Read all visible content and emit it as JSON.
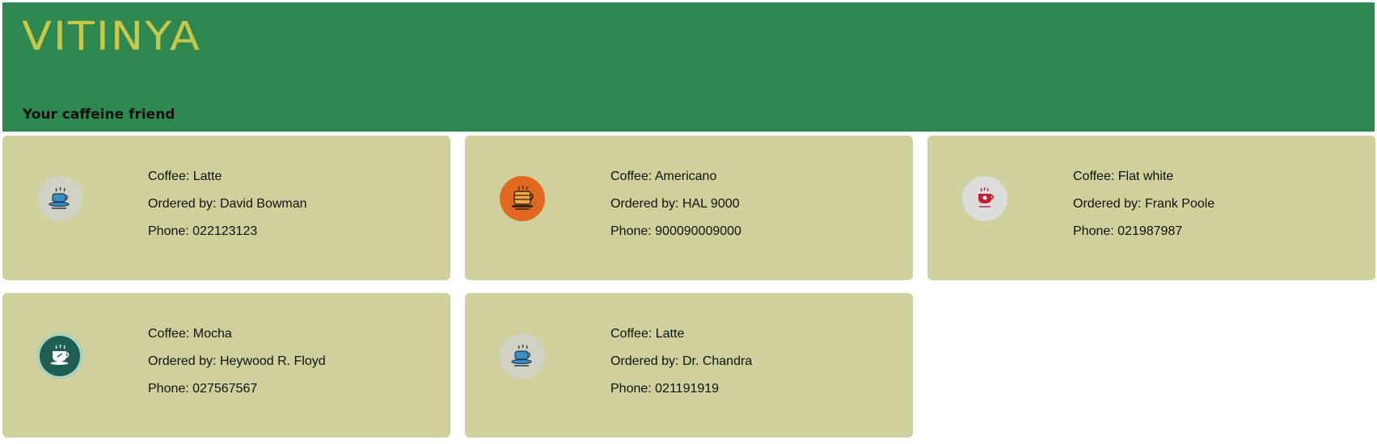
{
  "header": {
    "brand": "VITINYA",
    "tagline": "Your caffeine friend"
  },
  "labels": {
    "coffee": "Coffee: ",
    "ordered_by": "Ordered by: ",
    "phone": "Phone: "
  },
  "orders": [
    {
      "coffee": "Latte",
      "ordered_by": "David Bowman",
      "phone": "022123123",
      "icon": "coffee-cup-icon",
      "icon_bg": "#d3d1c4"
    },
    {
      "coffee": "Americano",
      "ordered_by": "HAL 9000",
      "phone": "900090009000",
      "icon": "coffee-cup-icon",
      "icon_bg": "#e0691f"
    },
    {
      "coffee": "Flat white",
      "ordered_by": "Frank Poole",
      "phone": "021987987",
      "icon": "coffee-cup-icon",
      "icon_bg": "#dcdcdc"
    },
    {
      "coffee": "Mocha",
      "ordered_by": "Heywood R. Floyd",
      "phone": "027567567",
      "icon": "coffee-cup-icon",
      "icon_bg": "#1f5e52"
    },
    {
      "coffee": "Latte",
      "ordered_by": "Dr. Chandra",
      "phone": "021191919",
      "icon": "coffee-cup-icon",
      "icon_bg": "#d3d1c4"
    }
  ],
  "colors": {
    "header_bg": "#2e8950",
    "brand": "#c9c74a",
    "card_bg": "#cfd09b"
  }
}
